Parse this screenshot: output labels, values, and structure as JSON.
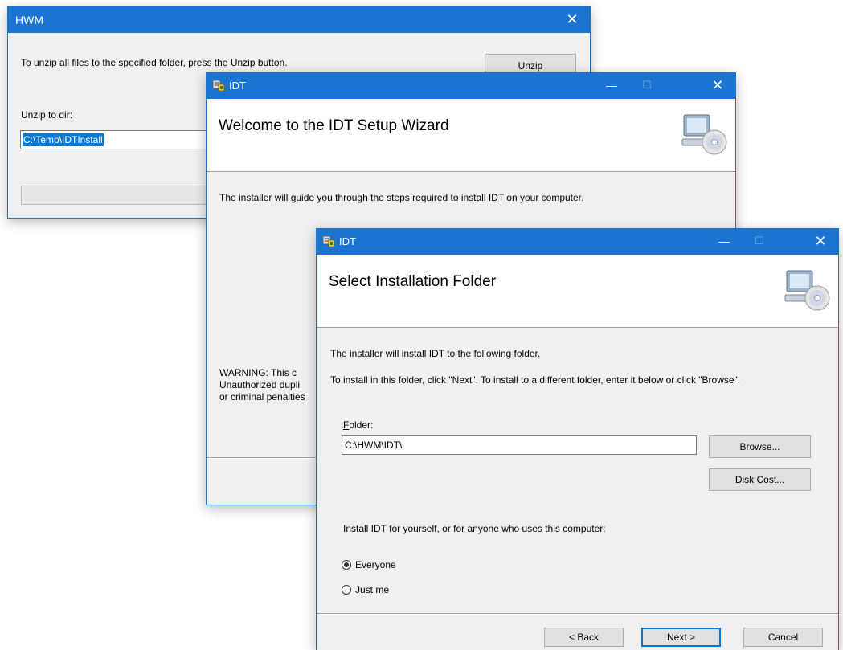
{
  "hwm": {
    "title": "HWM",
    "message": "To unzip all files to the specified folder, press the Unzip button.",
    "unzip_button": "Unzip",
    "unzip_dir_label": "Unzip to dir:",
    "unzip_dir_value": "C:\\Temp\\IDTInstall"
  },
  "welcome": {
    "title": "IDT",
    "heading": "Welcome to the IDT Setup Wizard",
    "body": "The installer will guide you through the steps required to install IDT on your computer.",
    "warning_lines": [
      "WARNING: This c",
      "Unauthorized dupli",
      "or criminal penalties"
    ]
  },
  "folder": {
    "title": "IDT",
    "heading": "Select Installation Folder",
    "intro": "The installer will install IDT to the following folder.",
    "instruction": "To install in this folder, click \"Next\". To install to a different folder, enter it below or click \"Browse\".",
    "folder_label_accel": "F",
    "folder_label_rest": "older:",
    "folder_value": "C:\\HWM\\IDT\\",
    "browse_button": "Browse...",
    "disk_cost_button": "Disk Cost...",
    "install_for_label": "Install IDT for yourself, or for anyone who uses this computer:",
    "options": [
      {
        "label": "Everyone",
        "selected": true
      },
      {
        "label": "Just me",
        "selected": false
      }
    ],
    "back_button": "< Back",
    "next_button": "Next >",
    "cancel_button": "Cancel"
  },
  "colors": {
    "titlebar": "#1a74d0",
    "selection": "#0078d7"
  }
}
